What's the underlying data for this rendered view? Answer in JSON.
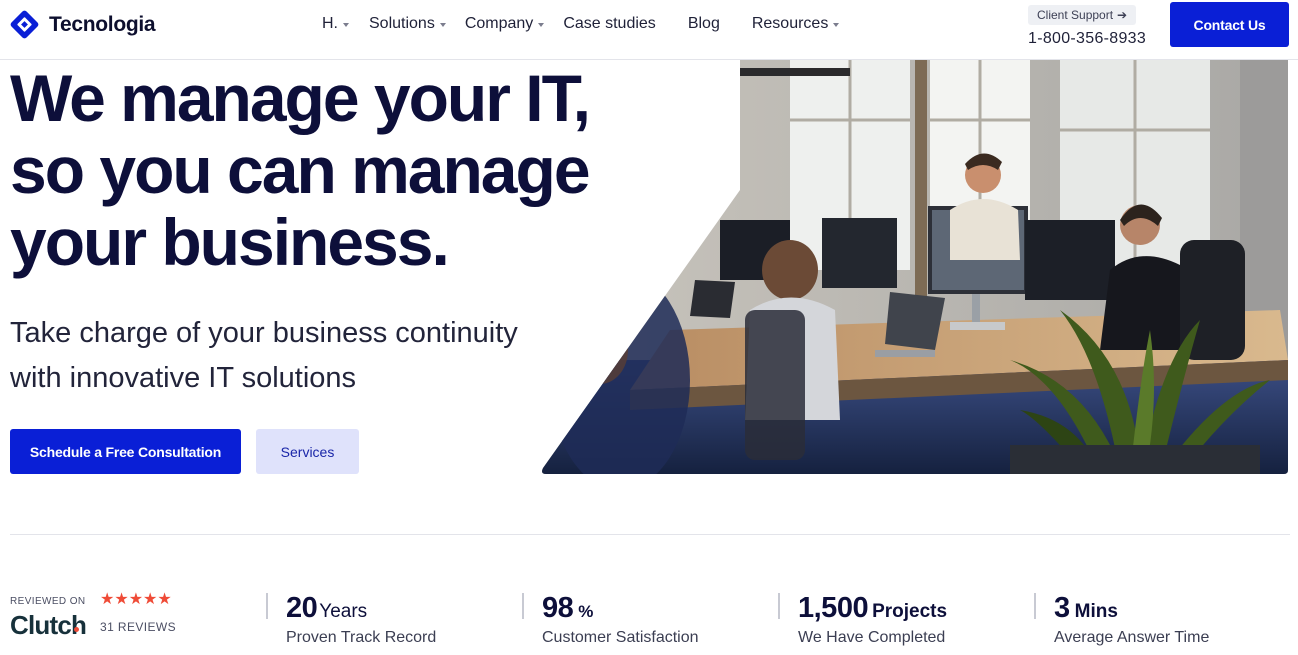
{
  "brand": {
    "name": "Tecnologia",
    "logo_icon": "diamond-logo-icon",
    "accent": "#0a1fd6"
  },
  "nav": {
    "items": [
      {
        "label": "H.",
        "dropdown": true
      },
      {
        "label": "Solutions",
        "dropdown": true
      },
      {
        "label": "Company",
        "dropdown": true
      },
      {
        "label": "Case studies",
        "dropdown": false
      },
      {
        "label": "Blog",
        "dropdown": false
      },
      {
        "label": "Resources",
        "dropdown": true
      }
    ]
  },
  "support": {
    "badge": "Client Support",
    "badge_icon": "arrow-right-icon",
    "phone": "1-800-356-8933"
  },
  "contact_button": "Contact Us",
  "hero": {
    "title_lines": [
      "We manage your IT,",
      "so you can manage",
      "your business."
    ],
    "subtitle_lines": [
      "Take charge of your business continuity",
      "with innovative IT solutions"
    ],
    "primary_button": "Schedule a Free Consultation",
    "secondary_button": "Services",
    "image": "office-team-working-photo"
  },
  "clutch": {
    "reviewed_on": "REVIEWED ON",
    "name": "Clutch",
    "stars": "★★★★★",
    "rating": 5,
    "reviews": "31 REVIEWS",
    "star_color": "#ef4b37"
  },
  "stats": [
    {
      "value": "20",
      "unit": "Years",
      "label": "Proven Track Record"
    },
    {
      "value": "98",
      "unit": "%",
      "label": "Customer Satisfaction"
    },
    {
      "value": "1,500",
      "unit": "Projects",
      "label": "We Have Completed"
    },
    {
      "value": "3",
      "unit": "Mins",
      "label": "Average Answer Time"
    }
  ]
}
